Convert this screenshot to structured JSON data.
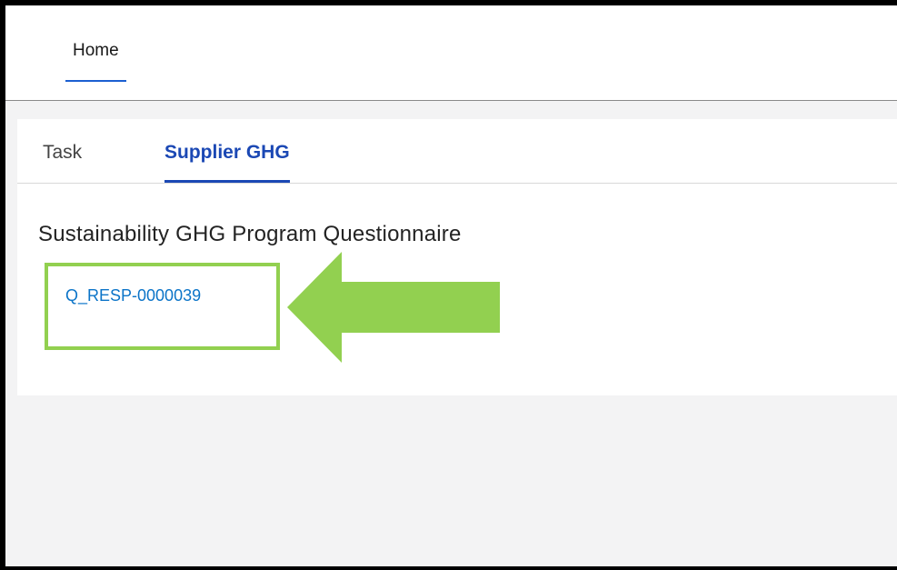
{
  "nav": {
    "home_label": "Home"
  },
  "tabs": [
    {
      "label": "Task",
      "active": false
    },
    {
      "label": "Supplier GHG",
      "active": true
    }
  ],
  "section": {
    "title": "Sustainability GHG Program Questionnaire",
    "record_link": "Q_RESP-0000039"
  },
  "annotation": {
    "highlight_color": "#92d050",
    "arrow_icon": "left-arrow-icon"
  },
  "colors": {
    "active_tab": "#1b48b4",
    "link": "#0b74c8",
    "nav_underline": "#1b5fd1"
  }
}
